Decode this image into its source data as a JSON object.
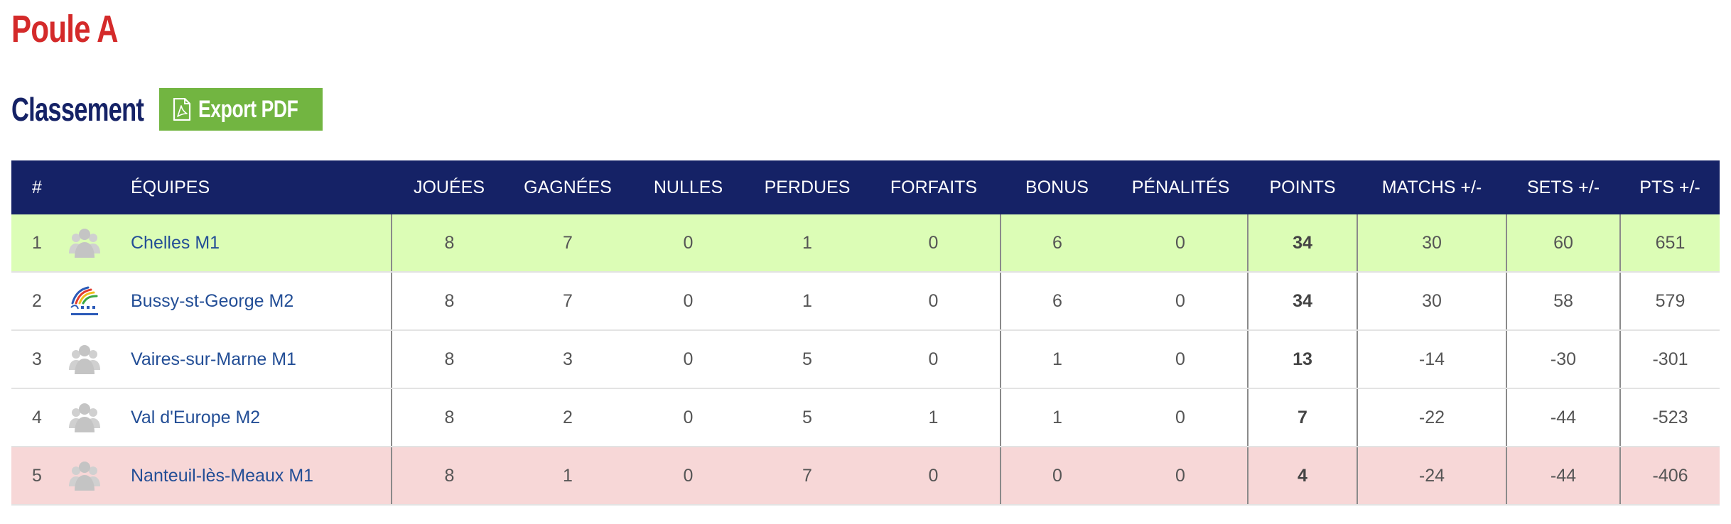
{
  "page": {
    "pool_title": "Poule A",
    "section_title": "Classement",
    "export_label": "Export PDF"
  },
  "colors": {
    "title_red": "#d42a2a",
    "navy": "#152266",
    "export_green": "#72b541",
    "promotion_row": "#dcfdb6",
    "relegation_row": "#f7d7d7",
    "team_link": "#234e96"
  },
  "table": {
    "headers": [
      "#",
      "ÉQUIPES",
      "JOUÉES",
      "GAGNÉES",
      "NULLES",
      "PERDUES",
      "FORFAITS",
      "BONUS",
      "PÉNALITÉS",
      "POINTS",
      "MATCHS +/-",
      "SETS +/-",
      "PTS +/-"
    ],
    "rows": [
      {
        "rank": "1",
        "logo": "group-placeholder-icon",
        "team": "Chelles M1",
        "played": "8",
        "won": "7",
        "draws": "0",
        "lost": "1",
        "forfeits": "0",
        "bonus": "6",
        "penalties": "0",
        "points": "34",
        "matches_diff": "30",
        "sets_diff": "60",
        "pts_diff": "651"
      },
      {
        "rank": "2",
        "logo": "bsg-badminton-logo",
        "team": "Bussy-st-George M2",
        "played": "8",
        "won": "7",
        "draws": "0",
        "lost": "1",
        "forfeits": "0",
        "bonus": "6",
        "penalties": "0",
        "points": "34",
        "matches_diff": "30",
        "sets_diff": "58",
        "pts_diff": "579"
      },
      {
        "rank": "3",
        "logo": "group-placeholder-icon",
        "team": "Vaires-sur-Marne M1",
        "played": "8",
        "won": "3",
        "draws": "0",
        "lost": "5",
        "forfeits": "0",
        "bonus": "1",
        "penalties": "0",
        "points": "13",
        "matches_diff": "-14",
        "sets_diff": "-30",
        "pts_diff": "-301"
      },
      {
        "rank": "4",
        "logo": "group-placeholder-icon",
        "team": "Val d'Europe M2",
        "played": "8",
        "won": "2",
        "draws": "0",
        "lost": "5",
        "forfeits": "1",
        "bonus": "1",
        "penalties": "0",
        "points": "7",
        "matches_diff": "-22",
        "sets_diff": "-44",
        "pts_diff": "-523"
      },
      {
        "rank": "5",
        "logo": "group-placeholder-icon",
        "team": "Nanteuil-lès-Meaux M1",
        "played": "8",
        "won": "1",
        "draws": "0",
        "lost": "7",
        "forfeits": "0",
        "bonus": "0",
        "penalties": "0",
        "points": "4",
        "matches_diff": "-24",
        "sets_diff": "-44",
        "pts_diff": "-406"
      }
    ]
  }
}
